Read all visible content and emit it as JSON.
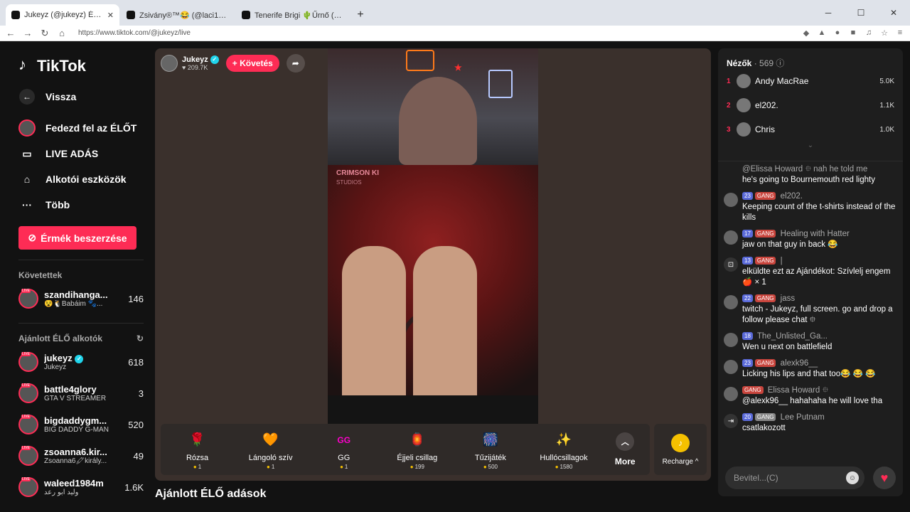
{
  "browser": {
    "tabs": [
      {
        "title": "Jukeyz (@jukeyz) ÉLŐ adása"
      },
      {
        "title": "Zsivány®™😂 (@laci1918) ÉLŐ"
      },
      {
        "title": "Tenerife Brigi 🌵Űrnő (@mazsi04) ÉL"
      }
    ],
    "url": "https://www.tiktok.com/@jukeyz/live"
  },
  "sidebar": {
    "brand": "TikTok",
    "back": "Vissza",
    "nav": [
      "Fedezd fel az ÉLŐT",
      "LIVE ADÁS",
      "Alkotói eszközök",
      "Több"
    ],
    "coins_button": "Érmék beszerzése",
    "following_title": "Követettek",
    "following": [
      {
        "name": "szandihanga...",
        "sub": "😵🐧Babáim 🐾...",
        "count": "146"
      }
    ],
    "recommended_title": "Ajánlott ÉLŐ alkotók",
    "recommended": [
      {
        "name": "jukeyz",
        "sub": "Jukeyz",
        "count": "618"
      },
      {
        "name": "battle4glory",
        "sub": "GTA V STREAMER",
        "count": "3"
      },
      {
        "name": "bigdaddygm...",
        "sub": "BIG DADDY G-MAN",
        "count": "520"
      },
      {
        "name": "zsoanna6.kir...",
        "sub": "Zsoanna6🖍király...",
        "count": "49"
      },
      {
        "name": "waleed1984m",
        "sub": "وليد ابو رعد",
        "count": "1.6K"
      }
    ]
  },
  "stream": {
    "host_name": "Jukeyz",
    "host_likes": "209.7K",
    "follow": "+ Követés",
    "video_overlay_title": "CRIMSON KI",
    "video_overlay_sub": "STUDIOS",
    "gifts": [
      {
        "name": "Rózsa",
        "price": "1",
        "icon": "🌹"
      },
      {
        "name": "Lángoló szív",
        "price": "1",
        "icon": "🧡"
      },
      {
        "name": "GG",
        "price": "1",
        "icon": "GG"
      },
      {
        "name": "Éjjeli csillag",
        "price": "199",
        "icon": "🏮"
      },
      {
        "name": "Tűzijáték",
        "price": "500",
        "icon": "🎆"
      },
      {
        "name": "Hullócsillagok",
        "price": "1580",
        "icon": "✨"
      }
    ],
    "more": "More",
    "recharge": "Recharge"
  },
  "recommended_heading": "Ajánlott ÉLŐ adások",
  "viewers": {
    "label": "Nézők",
    "count": "569",
    "top": [
      {
        "rank": "1",
        "name": "Andy MacRae",
        "score": "5.0K"
      },
      {
        "rank": "2",
        "name": "el202.",
        "score": "1.1K"
      },
      {
        "rank": "3",
        "name": "Chris",
        "score": "1.0K"
      }
    ]
  },
  "chat": [
    {
      "user": "@Elissa Howard ⯐ nah he told me",
      "text": "he's going to Bournemouth red lighty",
      "lvl": "",
      "gang": false
    },
    {
      "user": "el202.",
      "text": "Keeping count of the t-shirts instead of the kills",
      "lvl": "23",
      "gang": true
    },
    {
      "user": "Healing with Hatter",
      "text": "jaw on that guy in back 😂",
      "lvl": "17",
      "gang": true
    },
    {
      "user": "|",
      "text": "elküldte ezt az Ajándékot: Szívlelj engem 🍎 × 1",
      "lvl": "13",
      "gang": true
    },
    {
      "user": "jass",
      "text": "twitch - Jukeyz, full screen. go and drop a follow please chat ⯐",
      "lvl": "22",
      "gang": true
    },
    {
      "user": "The_Unlisted_Ga...",
      "text": "Wen u next on battlefield",
      "lvl": "18",
      "gang": false
    },
    {
      "user": "alexk96__",
      "text": "Licking his lips and that too😂 😂 😂",
      "lvl": "23",
      "gang": true
    },
    {
      "user": "Elissa Howard ⯐",
      "text": "@alexk96__ hahahaha he will love tha",
      "lvl": "",
      "gang": true
    },
    {
      "user": "Lee Putnam",
      "text": "csatlakozott",
      "lvl": "20",
      "gang": true
    }
  ],
  "chat_input_placeholder": "Bevitel...(C)"
}
